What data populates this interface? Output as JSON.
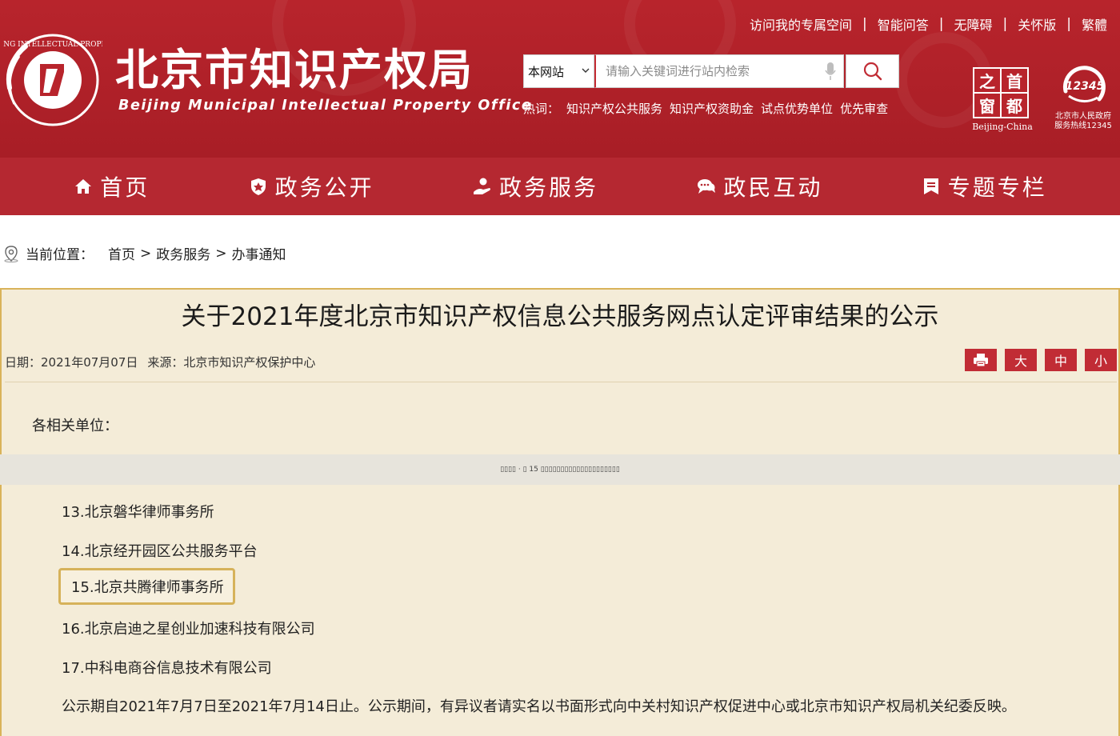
{
  "header": {
    "site_title": "北京市知识产权局",
    "site_subtitle": "Beijing Municipal Intellectual Property Office",
    "emblem_text": "BEIJING INTELLECTUAL PROPERTY",
    "top_links": [
      "访问我的专属空间",
      "智能问答",
      "无障碍",
      "关怀版",
      "繁體"
    ],
    "search": {
      "scope": "本网站",
      "placeholder": "请输入关键词进行站内检索"
    },
    "hotwords_label": "热词：",
    "hotwords": [
      "知识产权公共服务",
      "知识产权资助金",
      "试点优势单位",
      "优先审查"
    ],
    "capital_logo": {
      "chars": [
        "之",
        "首",
        "窗",
        "都"
      ],
      "caption": "Beijing-China"
    },
    "hotline": {
      "number": "12345",
      "caption_line1": "北京市人民政府",
      "caption_line2": "服务热线12345"
    }
  },
  "nav": [
    {
      "label": "首页",
      "icon": "home-icon"
    },
    {
      "label": "政务公开",
      "icon": "shield-icon"
    },
    {
      "label": "政务服务",
      "icon": "service-hand-icon"
    },
    {
      "label": "政民互动",
      "icon": "chat-bubbles-icon"
    },
    {
      "label": "专题专栏",
      "icon": "bookmark-list-icon"
    }
  ],
  "breadcrumb": {
    "label": "当前位置：",
    "items": [
      "首页",
      "政务服务",
      "办事通知"
    ],
    "separator": ">"
  },
  "article": {
    "title": "关于2021年度北京市知识产权信息公共服务网点认定评审结果的公示",
    "date_label": "日期：",
    "date": "2021年07月07日",
    "source_label": "来源：",
    "source": "北京市知识产权保护中心",
    "tools": [
      "print-icon",
      "大",
      "中",
      "小"
    ],
    "greeting": "各相关单位：",
    "omitted_banner": "▯▯▯▯ · ▯ 15 ▯▯▯▯▯▯▯▯▯▯▯▯▯▯▯▯▯▯▯▯",
    "entries": [
      "13.北京磐华律师事务所",
      "14.北京经开园区公共服务平台",
      "15.北京共腾律师事务所",
      "16.北京启迪之星创业加速科技有限公司",
      "17.中科电商谷信息技术有限公司"
    ],
    "notice": "公示期自2021年7月7日至2021年7月14日止。公示期间，有异议者请实名以书面形式向中关村知识产权促进中心或北京市知识产权局机关纪委反映。"
  },
  "colors": {
    "brand_red": "#b8242c",
    "nav_red": "#b52831",
    "article_bg": "#f4ecd8",
    "highlight_border": "#d6b25a"
  }
}
